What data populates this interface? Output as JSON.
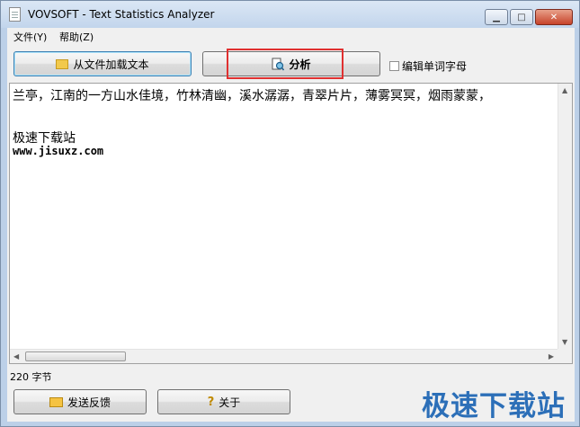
{
  "window": {
    "title": "VOVSOFT - Text Statistics Analyzer"
  },
  "menu": {
    "items": [
      "文件(Y)",
      "帮助(Z)"
    ]
  },
  "toolbar": {
    "load_label": "从文件加载文本",
    "analyze_label": "分析",
    "checkbox_label": "编辑单词字母",
    "checkbox_checked": false
  },
  "editor": {
    "lines": [
      "兰亭，江南的一方山水佳境，竹林清幽，溪水潺潺，青翠片片，薄雾冥冥，烟雨蒙蒙，",
      "",
      "极速下载站",
      "www.jisuxz.com"
    ]
  },
  "status": {
    "text": "220 字节"
  },
  "bottom": {
    "feedback_label": "发送反馈",
    "about_label": "关于"
  },
  "watermark": {
    "text": "极速下载站"
  },
  "colors": {
    "highlight": "#e03030",
    "accent": "#3c7fb1",
    "watermark": "#2c6fb8"
  }
}
